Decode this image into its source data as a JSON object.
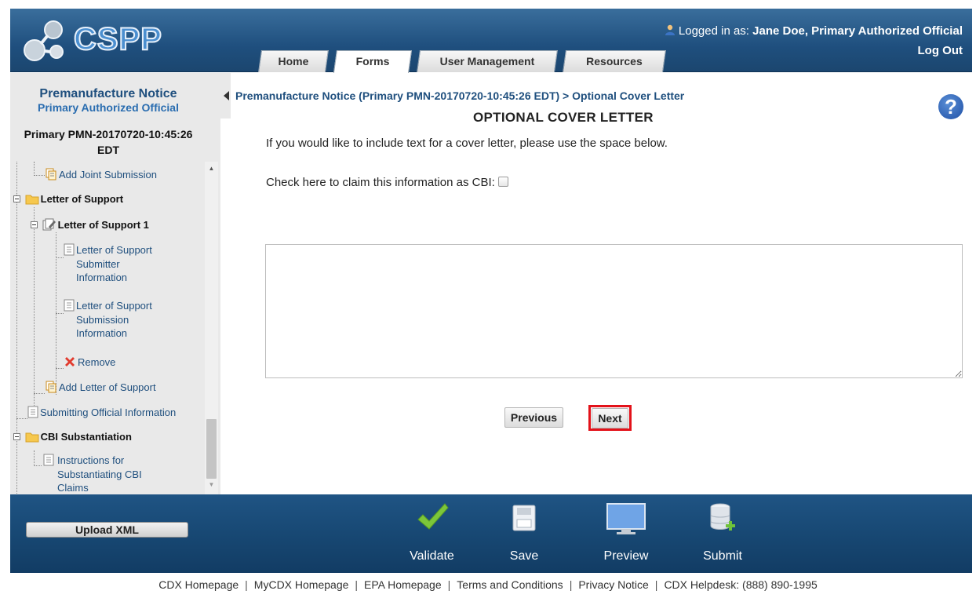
{
  "header": {
    "app_name": "CSPP",
    "logged_in_prefix": "Logged in as: ",
    "logged_in_user": "Jane Doe, Primary Authorized Official",
    "logout": "Log Out",
    "tabs": [
      {
        "label": "Home",
        "active": false
      },
      {
        "label": "Forms",
        "active": true
      },
      {
        "label": "User Management",
        "active": false
      },
      {
        "label": "Resources",
        "active": false
      }
    ]
  },
  "sidebar": {
    "title": "Premanufacture Notice",
    "subtitle": "Primary Authorized Official",
    "pmn_line1": "Primary PMN-20170720-10:45:26",
    "pmn_line2": "EDT",
    "tree": [
      {
        "label": "Add Joint Submission"
      },
      {
        "label": "Letter of Support"
      },
      {
        "label": "Letter of Support 1"
      },
      {
        "label": "Letter of Support Submitter Information"
      },
      {
        "label": "Letter of Support Submission Information"
      },
      {
        "label": "Remove"
      },
      {
        "label": "Add Letter of Support"
      },
      {
        "label": "Submitting Official Information"
      },
      {
        "label": "CBI Substantiation"
      },
      {
        "label": "Instructions for Substantiating CBI Claims"
      }
    ]
  },
  "main": {
    "breadcrumb": "Premanufacture Notice (Primary PMN-20170720-10:45:26 EDT) > Optional Cover Letter",
    "title": "OPTIONAL COVER LETTER",
    "intro": "If you would like to include text for a cover letter, please use the space below.",
    "cbi_label": "Check here to claim this information as CBI:",
    "cbi_checked": false,
    "cover_letter_value": "",
    "previous_label": "Previous",
    "next_label": "Next"
  },
  "toolbar": {
    "upload_label": "Upload XML",
    "validate": "Validate",
    "save": "Save",
    "preview": "Preview",
    "submit": "Submit"
  },
  "footer": {
    "links": [
      "CDX Homepage",
      "MyCDX Homepage",
      "EPA Homepage",
      "Terms and Conditions",
      "Privacy Notice",
      "CDX Helpdesk: (888) 890-1995"
    ]
  },
  "colors": {
    "header_blue": "#1f4f7e",
    "highlight_red": "#e3121a",
    "sidebar_bg": "#e9e9e9"
  }
}
